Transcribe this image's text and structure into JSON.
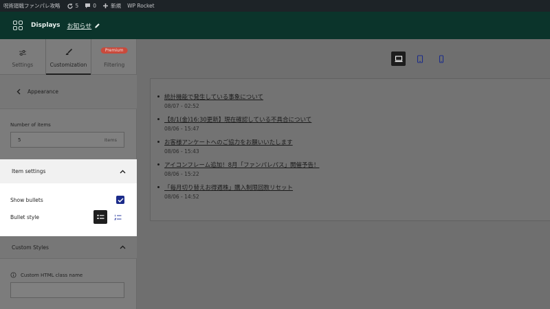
{
  "admin_bar": {
    "site_name": "呪術廻戦ファンパレ攻略",
    "updates_count": "5",
    "comments_count": "0",
    "new_label": "新規",
    "wp_rocket_label": "WP Rocket"
  },
  "plugin_header": {
    "title": "Displays",
    "display_name": "お知らせ"
  },
  "tabs": [
    {
      "label": "Settings"
    },
    {
      "label": "Customization"
    },
    {
      "label": "Filtering",
      "badge": "Premium"
    }
  ],
  "panel": {
    "section_title": "Appearance",
    "number_of_items_label": "Number of items",
    "number_of_items_value": "5",
    "number_of_items_unit": "Items",
    "item_settings_title": "Item settings",
    "show_bullets_label": "Show bullets",
    "bullet_style_label": "Bullet style",
    "custom_styles_title": "Custom Styles",
    "html_class_label": "Custom HTML class name",
    "html_class_value": ""
  },
  "preview_items": [
    {
      "title": "統計機能で発生している事象について",
      "date": "08/07 - 02:52"
    },
    {
      "title": "【8/1(金)16:30更新】現在確認している不具合について",
      "date": "08/06 - 15:47"
    },
    {
      "title": "お客様アンケートへのご協力をお願いいたします",
      "date": "08/06 - 15:43"
    },
    {
      "title": "アイコンフレーム追加！8月「ファンパレパス」開催予告！",
      "date": "08/06 - 15:22"
    },
    {
      "title": "「毎月切り替えお得週株」購入制限回数リセット",
      "date": "08/06 - 14:52"
    }
  ],
  "colors": {
    "admin_bar_bg": "#1d2327",
    "header_bg": "#0b342b",
    "checkbox_blue": "#1b2b8a",
    "premium_badge": "#c94a3c"
  },
  "icons": [
    "grid-icon",
    "pencil-icon",
    "sliders-icon",
    "brush-icon",
    "chevron-left-icon",
    "chevron-up-icon",
    "check-icon",
    "list-bullet-icon",
    "list-numbered-icon",
    "info-icon",
    "desktop-icon",
    "tablet-icon",
    "mobile-icon",
    "refresh-icon",
    "comment-icon",
    "plus-icon"
  ]
}
